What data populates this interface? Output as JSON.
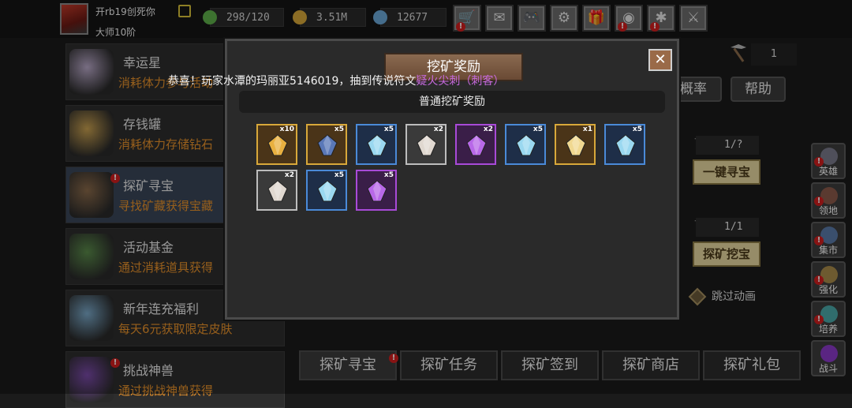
{
  "player": {
    "name": "开rb19创死你",
    "rank": "大师10阶"
  },
  "resources": [
    {
      "icon": "energy-icon",
      "value": "298/120",
      "color": "#5fb04a"
    },
    {
      "icon": "gold-coin-icon",
      "value": "3.51M",
      "color": "#d8a83a"
    },
    {
      "icon": "diamond-icon",
      "value": "12677",
      "color": "#6aa8d8"
    }
  ],
  "toolbar": [
    {
      "icon": "shop-cart-icon",
      "glyph": "🛒",
      "alert": true
    },
    {
      "icon": "mail-icon",
      "glyph": "✉",
      "alert": false
    },
    {
      "icon": "gamepad-icon",
      "glyph": "🎮",
      "alert": false
    },
    {
      "icon": "settings-gear-icon",
      "glyph": "⚙",
      "alert": false
    },
    {
      "icon": "gift-icon",
      "glyph": "🎁",
      "alert": false
    },
    {
      "icon": "wheel-icon",
      "glyph": "◉",
      "alert": true
    },
    {
      "icon": "spider-icon",
      "glyph": "✱",
      "alert": true
    },
    {
      "icon": "swords-icon",
      "glyph": "⚔",
      "alert": false
    }
  ],
  "sidebar": {
    "items": [
      {
        "title": "幸运星",
        "desc": "消耗体力参与活动",
        "alert": false,
        "active": false,
        "color": "#b8a8c8"
      },
      {
        "title": "存钱罐",
        "desc": "消耗体力存储钻石",
        "alert": false,
        "active": false,
        "color": "#c8a050"
      },
      {
        "title": "探矿寻宝",
        "desc": "寻找矿藏获得宝藏",
        "alert": true,
        "active": true,
        "color": "#8a6a4a"
      },
      {
        "title": "活动基金",
        "desc": "通过消耗道具获得",
        "alert": false,
        "active": false,
        "color": "#5a8a4a"
      },
      {
        "title": "新年连充福利",
        "desc": "每天6元获取限定皮肤",
        "alert": false,
        "active": false,
        "color": "#7aa8c8"
      },
      {
        "title": "挑战神兽",
        "desc": "通过挑战神兽获得",
        "alert": true,
        "active": false,
        "color": "#7a4aa8"
      }
    ]
  },
  "mining": {
    "pick_count": "1",
    "rate_label": "概率",
    "help_label": "帮助",
    "one_click_cost": "1/?",
    "one_click_label": "一键寻宝",
    "dig_cost": "1/1",
    "dig_label": "探矿挖宝",
    "skip_label": "跳过动画"
  },
  "right_rail": [
    {
      "label": "英雄",
      "icon": "hero-helmet-icon",
      "color": "#7a7a8a"
    },
    {
      "label": "领地",
      "icon": "territory-castle-icon",
      "color": "#8a5a4a"
    },
    {
      "label": "集市",
      "icon": "market-stall-icon",
      "color": "#5a7aa8"
    },
    {
      "label": "强化",
      "icon": "enhance-anvil-icon",
      "color": "#a88a4a"
    },
    {
      "label": "培养",
      "icon": "train-potion-icon",
      "color": "#4aa8a8"
    },
    {
      "label": "战斗",
      "icon": "battle-portal-icon",
      "color": "#8a3ac8"
    }
  ],
  "bottom_tabs": [
    {
      "label": "探矿寻宝",
      "active": true,
      "alert": true
    },
    {
      "label": "探矿任务",
      "active": false,
      "alert": false
    },
    {
      "label": "探矿签到",
      "active": false,
      "alert": false
    },
    {
      "label": "探矿商店",
      "active": false,
      "alert": false
    },
    {
      "label": "探矿礼包",
      "active": false,
      "alert": false
    }
  ],
  "modal": {
    "title": "挖矿奖励",
    "close_glyph": "✕",
    "subheader": "普通挖矿奖励",
    "announcement_prefix": "恭喜！玩家水潭的玛丽亚5146019，抽到传说符文",
    "announcement_item": "疑火尖刺（刺客）",
    "rewards": [
      {
        "name": "amber-shard",
        "qty": "x10",
        "border": "#d8a83a",
        "bg": "#4a3418",
        "gem": "#e8b040"
      },
      {
        "name": "blue-ore",
        "qty": "x5",
        "border": "#d8a83a",
        "bg": "#4a3418",
        "gem": "#5a78b8"
      },
      {
        "name": "ice-crystal",
        "qty": "x5",
        "border": "#4a8ad8",
        "bg": "#1e2e48",
        "gem": "#9ad8f0"
      },
      {
        "name": "treasure-chest",
        "qty": "x2",
        "border": "#bdbdbd",
        "bg": "#3a3a3a",
        "gem": "#e0d8d0"
      },
      {
        "name": "purple-crystal",
        "qty": "x2",
        "border": "#a84ad8",
        "bg": "#3a1e48",
        "gem": "#b868e8"
      },
      {
        "name": "ice-crystal",
        "qty": "x5",
        "border": "#4a8ad8",
        "bg": "#1e2e48",
        "gem": "#9ad8f0"
      },
      {
        "name": "golden-egg",
        "qty": "x1",
        "border": "#d8a83a",
        "bg": "#4a3418",
        "gem": "#f0d890"
      },
      {
        "name": "ice-crystal",
        "qty": "x5",
        "border": "#4a8ad8",
        "bg": "#1e2e48",
        "gem": "#9ad8f0"
      },
      {
        "name": "treasure-chest",
        "qty": "x2",
        "border": "#bdbdbd",
        "bg": "#3a3a3a",
        "gem": "#e0d8d0"
      },
      {
        "name": "ice-crystal",
        "qty": "x5",
        "border": "#4a8ad8",
        "bg": "#1e2e48",
        "gem": "#9ad8f0"
      },
      {
        "name": "purple-crystal",
        "qty": "x5",
        "border": "#a84ad8",
        "bg": "#3a1e48",
        "gem": "#b868e8"
      }
    ]
  }
}
